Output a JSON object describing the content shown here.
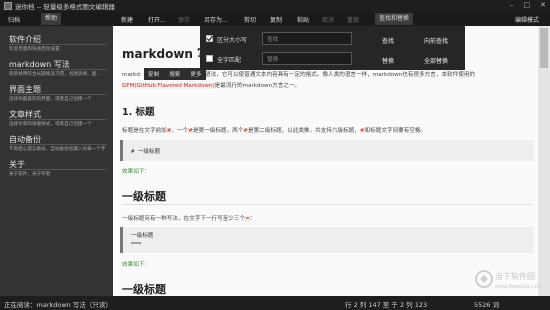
{
  "window": {
    "title": "迷你档 -- 轻量级多格式图文编辑器"
  },
  "menu": {
    "items": [
      "新建",
      "打开...",
      "保存",
      "另存为...",
      "剪切",
      "复制",
      "粘贴",
      "取消",
      "重做",
      "查找和替换"
    ],
    "right": "编辑模式",
    "left_tabs": [
      "归档",
      "帮助"
    ]
  },
  "sidebar": {
    "items": [
      {
        "title": "软件介绍",
        "desc": "欢迎页面和快速启动设置"
      },
      {
        "title": "markdown 写法",
        "desc": "简单易用符合长期阅读习惯，创建表格、图..."
      },
      {
        "title": "界面主题",
        "desc": "选择你最喜欢的界面，或者自己创建一个"
      },
      {
        "title": "文章样式",
        "desc": "选择文章的排版样式，或者自己创建一个"
      },
      {
        "title": "自动备份",
        "desc": "不再担心遗忘备份，自动备份您输入的每一个字"
      },
      {
        "title": "关于",
        "desc": "关于软件，关于作者"
      }
    ]
  },
  "find": {
    "case_label": "区分大小写",
    "whole_label": "全字匹配",
    "find_placeholder": "查找",
    "replace_placeholder": "替换",
    "find_btn": "查找",
    "find_up_btn": "向前查找",
    "replace_btn": "替换",
    "replace_all_btn": "全部替换"
  },
  "mini_toolbar": [
    "复制",
    "搜索",
    "更多"
  ],
  "doc": {
    "title": "markdown 写法",
    "p1a": "markd",
    "p1b": "语法，它可以使普通文本内容具有一定的格式。像人类的语言一样，markdown也有很多方言，本软件使用的",
    "gfm": "GFM(GitHub Flavored Markdown)",
    "p2b": "是最流行的markdown方言之一。",
    "h_title": "1. 标题",
    "h_text_a": "标题是在文字前加",
    "h_text_b": "，一个",
    "h_text_c": "是第一级标题，两个",
    "h_text_d": "是第二级标题，以此类推，共支持六级标题，",
    "h_text_e": "和标题文字间要有空格。",
    "hash": "#",
    "code1": "# 一级标题",
    "effect1": "效果如下：",
    "big_h1": "一级标题",
    "alt_text": "一级标题另有一种写法，在文字下一行写至少三个",
    "eq": "=",
    "colon": "：",
    "code2_line1": "一级标题",
    "code2_line2": "===",
    "effect2": "效果如下：",
    "big_h1b": "一级标题"
  },
  "status": {
    "left": "正在阅读：markdown 写法（只读）",
    "pos": "行 2 列 147 至 于 2 列 123",
    "chars": "5526 词"
  },
  "watermark": {
    "line1": "当下软件园",
    "line2": "www.downxia.com"
  }
}
